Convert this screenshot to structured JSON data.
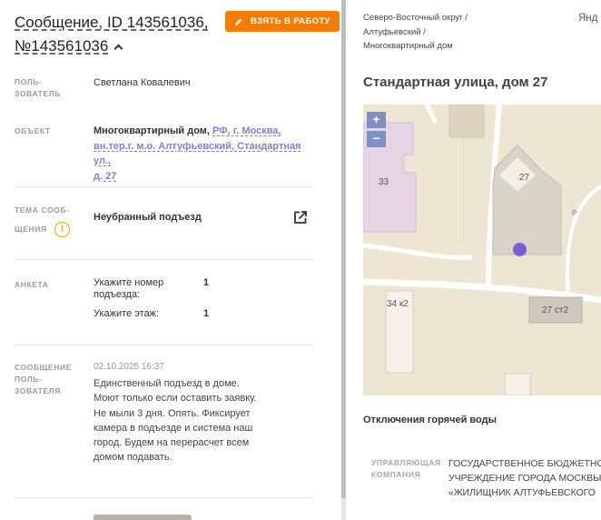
{
  "message": {
    "title_line1": "Сообщение, ID 143561036,",
    "title_line2": "№143561036",
    "take_button": "ВЗЯТЬ В РАБОТУ"
  },
  "fields": {
    "user_label_1": "ПОЛЬ-",
    "user_label_2": "ЗОВАТЕЛЬ",
    "user_value": "Светлана Ковалевич",
    "object_label": "ОБЪЕКТ",
    "object_type": "Многоквартирный дом,",
    "object_link_1": "РФ, г. Москва,",
    "object_link_2": "вн.тер.г. м.о. Алтуфьевский, Стандартная ул.,",
    "object_link_3": "д. 27",
    "topic_label_1": "ТЕМА СООБ-",
    "topic_label_2": "ЩЕНИЯ",
    "topic_value": "Неубранный подъезд",
    "survey_label": "АНКЕТА",
    "survey_q1_line1": "Укажите номер",
    "survey_q1_line2": "подъезда:",
    "survey_a1": "1",
    "survey_q2": "Укажите этаж:",
    "survey_a2": "1",
    "msg_label_1": "СООБЩЕНИЕ",
    "msg_label_2": "ПОЛЬ-",
    "msg_label_3": "ЗОВАТЕЛЯ",
    "msg_date": "02.10.2025 16:37",
    "msg_text": "Единственный подъезд в доме. Моют только если оставить заявку. Не мыли 3 дня. Опять. Фиксирует камера в подъезде и система наш город. Будем на перерасчет всем домом подавать."
  },
  "location": {
    "crumb_1": "Северо-Восточный округ /",
    "crumb_2": "Алтуфьевский /",
    "crumb_3": "Многоквартирный дом",
    "yandex": "Янд",
    "address": "Стандартная улица, дом 27"
  },
  "map": {
    "zoom_in": "+",
    "zoom_out": "−",
    "bld_33": "33",
    "bld_27": "27",
    "bld_34k2": "34 к2",
    "bld_27s2": "27 ст2",
    "road_mark": "Р",
    "marker_color": "#7b5cd6"
  },
  "hot_water": {
    "title": "Отключения горячей воды",
    "mc_label_1": "УПРАВЛЯЮЩАЯ",
    "mc_label_2": "КОМПАНИЯ",
    "mc_line1": "ГОСУДАРСТВЕННОЕ БЮДЖЕТНО",
    "mc_line2": "УЧРЕЖДЕНИЕ ГОРОДА МОСКВЫ",
    "mc_line3": "«ЖИЛИЩНИК АЛТУФЬЕВСКОГО"
  },
  "colors": {
    "accent": "#f57c00",
    "link": "#8a7bd6",
    "warning": "#f0a500"
  }
}
